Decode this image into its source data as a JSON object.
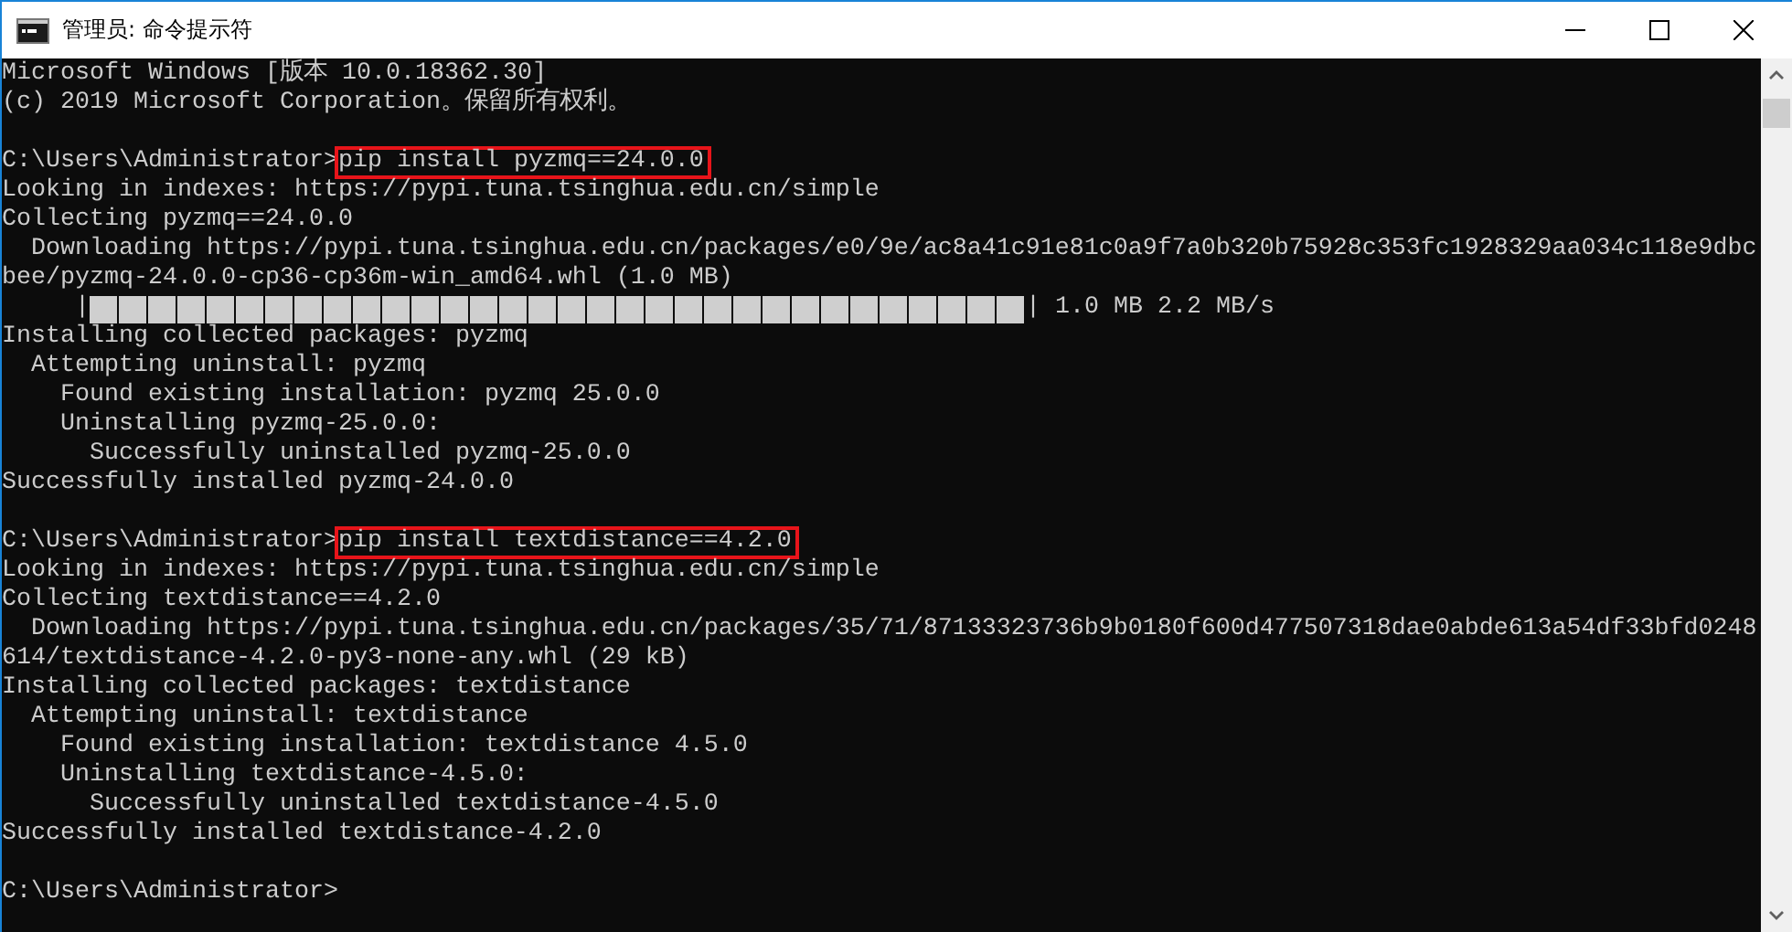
{
  "window": {
    "title": "管理员: 命令提示符"
  },
  "console": {
    "lines": [
      {
        "kind": "text",
        "text": "Microsoft Windows [版本 10.0.18362.30]"
      },
      {
        "kind": "text",
        "text": "(c) 2019 Microsoft Corporation。保留所有权利。"
      },
      {
        "kind": "blank"
      },
      {
        "kind": "prompt",
        "prompt": "C:\\Users\\Administrator>",
        "command": "pip install pyzmq==24.0.0",
        "highlighted": true
      },
      {
        "kind": "text",
        "text": "Looking in indexes: https://pypi.tuna.tsinghua.edu.cn/simple"
      },
      {
        "kind": "text",
        "text": "Collecting pyzmq==24.0.0"
      },
      {
        "kind": "text",
        "text": "  Downloading https://pypi.tuna.tsinghua.edu.cn/packages/e0/9e/ac8a41c91e81c0a9f7a0b320b75928c353fc1928329aa034c118e9dbc"
      },
      {
        "kind": "text",
        "text": "bee/pyzmq-24.0.0-cp36-cp36m-win_amd64.whl (1.0 MB)"
      },
      {
        "kind": "progress",
        "left_edge": "|",
        "level": 1,
        "right_edge": "|",
        "reading": "1.0 MB 2.2 MB/s"
      },
      {
        "kind": "text",
        "text": "Installing collected packages: pyzmq"
      },
      {
        "kind": "text",
        "text": "  Attempting uninstall: pyzmq"
      },
      {
        "kind": "text",
        "text": "    Found existing installation: pyzmq 25.0.0"
      },
      {
        "kind": "text",
        "text": "    Uninstalling pyzmq-25.0.0:"
      },
      {
        "kind": "text",
        "text": "      Successfully uninstalled pyzmq-25.0.0"
      },
      {
        "kind": "text",
        "text": "Successfully installed pyzmq-24.0.0"
      },
      {
        "kind": "blank"
      },
      {
        "kind": "prompt",
        "prompt": "C:\\Users\\Administrator>",
        "command": "pip install textdistance==4.2.0",
        "highlighted": true
      },
      {
        "kind": "text",
        "text": "Looking in indexes: https://pypi.tuna.tsinghua.edu.cn/simple"
      },
      {
        "kind": "text",
        "text": "Collecting textdistance==4.2.0"
      },
      {
        "kind": "text",
        "text": "  Downloading https://pypi.tuna.tsinghua.edu.cn/packages/35/71/87133323736b9b0180f600d477507318dae0abde613a54df33bfd0248"
      },
      {
        "kind": "text",
        "text": "614/textdistance-4.2.0-py3-none-any.whl (29 kB)"
      },
      {
        "kind": "text",
        "text": "Installing collected packages: textdistance"
      },
      {
        "kind": "text",
        "text": "  Attempting uninstall: textdistance"
      },
      {
        "kind": "text",
        "text": "    Found existing installation: textdistance 4.5.0"
      },
      {
        "kind": "text",
        "text": "    Uninstalling textdistance-4.5.0:"
      },
      {
        "kind": "text",
        "text": "      Successfully uninstalled textdistance-4.5.0"
      },
      {
        "kind": "text",
        "text": "Successfully installed textdistance-4.2.0"
      },
      {
        "kind": "blank"
      },
      {
        "kind": "prompt",
        "prompt": "C:\\Users\\Administrator>"
      }
    ]
  }
}
